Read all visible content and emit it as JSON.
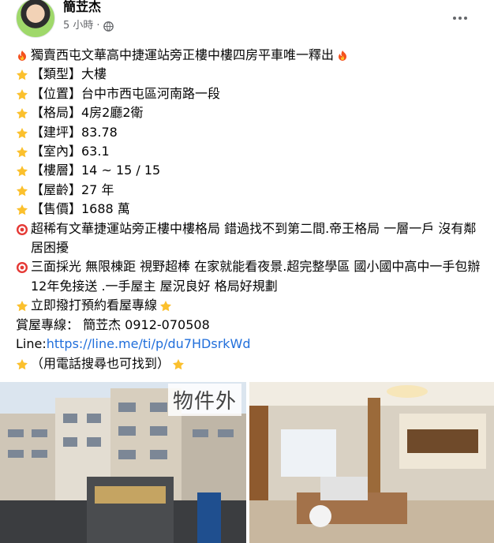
{
  "post": {
    "author": "簡苙杰",
    "time": "5 小時",
    "separator": "·",
    "lines": [
      {
        "emoji": "fire",
        "text": "獨賣西屯文華高中捷運站旁正樓中樓四房平車唯一釋出",
        "trail": "fire"
      },
      {
        "emoji": "star",
        "text": "【類型】大樓"
      },
      {
        "emoji": "star",
        "text": "【位置】台中市西屯區河南路一段"
      },
      {
        "emoji": "star",
        "text": "【格局】4房2廳2衛"
      },
      {
        "emoji": "star",
        "text": "【建坪】83.78"
      },
      {
        "emoji": "star",
        "text": "【室內】63.1"
      },
      {
        "emoji": "star",
        "text": "【樓層】14 ~ 15 / 15"
      },
      {
        "emoji": "star",
        "text": "【屋齡】27 年"
      },
      {
        "emoji": "star",
        "text": "【售價】1688 萬"
      },
      {
        "emoji": "target",
        "text": "超稀有文華捷運站旁正樓中樓格局 錯過找不到第二間.帝王格局 一層一戶 沒有鄰居困擾"
      },
      {
        "emoji": "target",
        "text": "三面採光 無限棟距 視野超棒 在家就能看夜景.超完整學區 國小國中高中一手包辦 12年免接送 .一手屋主 屋況良好 格局好規劃"
      },
      {
        "emoji": "star",
        "text": "立即撥打預約看屋專線",
        "trail": "star"
      },
      {
        "emoji": "",
        "text": "賞屋專線： 簡苙杰 0912-070508"
      },
      {
        "emoji": "",
        "text": "Line:",
        "link": "https://line.me/ti/p/du7HDsrkWd"
      },
      {
        "emoji": "star",
        "text": "（用電話搜尋也可找到）",
        "trail": "star"
      }
    ]
  },
  "photos": {
    "left_tag": "物件外"
  },
  "icons": {
    "globe": "globe-icon",
    "more": "more-options-icon",
    "fire": "fire-emoji-icon",
    "star": "star-emoji-icon",
    "target": "target-emoji-icon"
  },
  "colors": {
    "link": "#216fdb",
    "meta": "#65676b"
  }
}
